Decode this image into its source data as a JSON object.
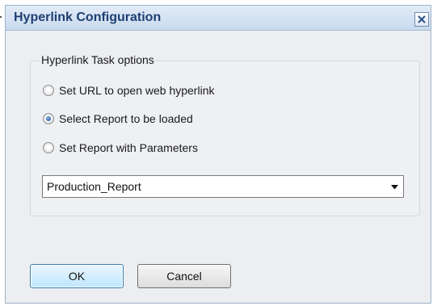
{
  "dialog": {
    "title": "Hyperlink Configuration",
    "close_icon": "close-icon"
  },
  "group": {
    "legend": "Hyperlink Task options",
    "options": [
      {
        "label": "Set URL to open web hyperlink",
        "checked": false
      },
      {
        "label": "Select Report to be loaded",
        "checked": true
      },
      {
        "label": "Set Report with Parameters",
        "checked": false
      }
    ],
    "report_select": {
      "value": "Production_Report",
      "icon": "dropdown-arrow-icon"
    }
  },
  "buttons": {
    "ok": "OK",
    "cancel": "Cancel"
  },
  "colors": {
    "title_text": "#1e3f73",
    "titlebar": "#c9d9ee",
    "dialog_bg": "#eceef2",
    "ok_border": "#3c7fb1"
  }
}
